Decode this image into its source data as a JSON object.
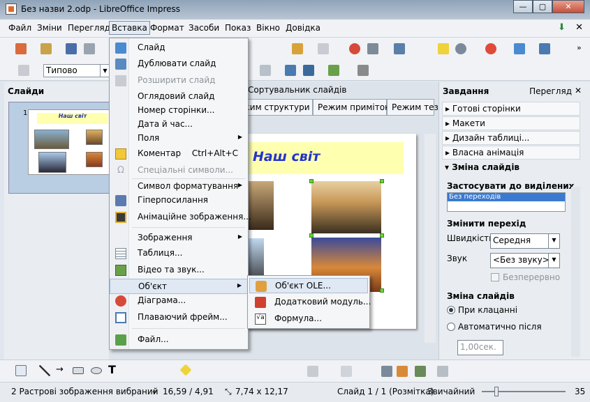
{
  "window": {
    "title": "Без назви 2.odp - LibreOffice Impress",
    "min": "—",
    "max": "▢",
    "close": "✕"
  },
  "menubar": [
    "Файл",
    "Зміни",
    "Перегляд",
    "Вставка",
    "Формат",
    "Засоби",
    "Показ",
    "Вікно",
    "Довідка"
  ],
  "toolbar": {
    "style_value": "Типово"
  },
  "slides_panel": {
    "title": "Слайди",
    "slide_number": "1",
    "thumb_title": "Наш світ"
  },
  "center": {
    "sorter_label": "Сортувальник слайдів",
    "tabs": [
      "жим структури",
      "Режим приміток",
      "Режим тез"
    ],
    "slide_title": "Наш світ"
  },
  "tasks": {
    "title": "Завдання",
    "view": "Перегляд",
    "close": "✕",
    "sections": [
      "Готові сторінки",
      "Макети",
      "Дизайн таблиці...",
      "Власна анімація",
      "Зміна слайдів"
    ],
    "apply_label": "Застосувати до виділених с...",
    "transition_item": "Без переходів",
    "change_transition": "Змінити перехід",
    "speed_label": "Швидкість",
    "speed_value": "Середня",
    "sound_label": "Звук",
    "sound_value": "<Без звуку>",
    "loop_label": "Безперервно",
    "advance_label": "Зміна слайдів",
    "on_click": "При клацанні",
    "auto_after": "Автоматично після",
    "auto_value": "1,00сек."
  },
  "insert_menu": {
    "items": [
      {
        "label": "Слайд",
        "icon": "slide-icon"
      },
      {
        "label": "Дублювати слайд",
        "icon": "duplicate-icon"
      },
      {
        "label": "Розширити слайд",
        "disabled": true
      },
      {
        "label": "Оглядовий слайд"
      },
      {
        "label": "Номер сторінки..."
      },
      {
        "label": "Дата й час..."
      },
      {
        "label": "Поля",
        "submenu": true
      },
      {
        "label": "Коментар",
        "shortcut": "Ctrl+Alt+C",
        "icon": "comment-icon"
      },
      {
        "label": "Спеціальні символи...",
        "disabled": true,
        "icon": "special-char-icon"
      },
      {
        "label": "Символ форматування",
        "submenu": true
      },
      {
        "label": "Гіперпосилання",
        "icon": "hyperlink-icon"
      },
      {
        "label": "Анімаційне зображення...",
        "icon": "animation-icon"
      },
      {
        "label": "Зображення",
        "submenu": true
      },
      {
        "label": "Таблиця...",
        "icon": "table-icon"
      },
      {
        "label": "Відео та звук...",
        "icon": "media-icon"
      },
      {
        "label": "Об'єкт",
        "submenu": true,
        "highlighted": true
      },
      {
        "label": "Діаграма...",
        "icon": "chart-icon"
      },
      {
        "label": "Плаваючий фрейм...",
        "icon": "frame-icon"
      },
      {
        "label": "Файл...",
        "icon": "file-icon"
      }
    ]
  },
  "object_submenu": [
    "Об'єкт OLE...",
    "Додатковий модуль...",
    "Формула..."
  ],
  "statusbar": {
    "selection": "2 Растрові зображення вибраний",
    "position": "16,59 / 4,91",
    "size": "7,74 x 12,17",
    "slide": "Слайд 1 / 1 (Розмітка)",
    "layout": "Звичайний",
    "zoom": "35"
  }
}
